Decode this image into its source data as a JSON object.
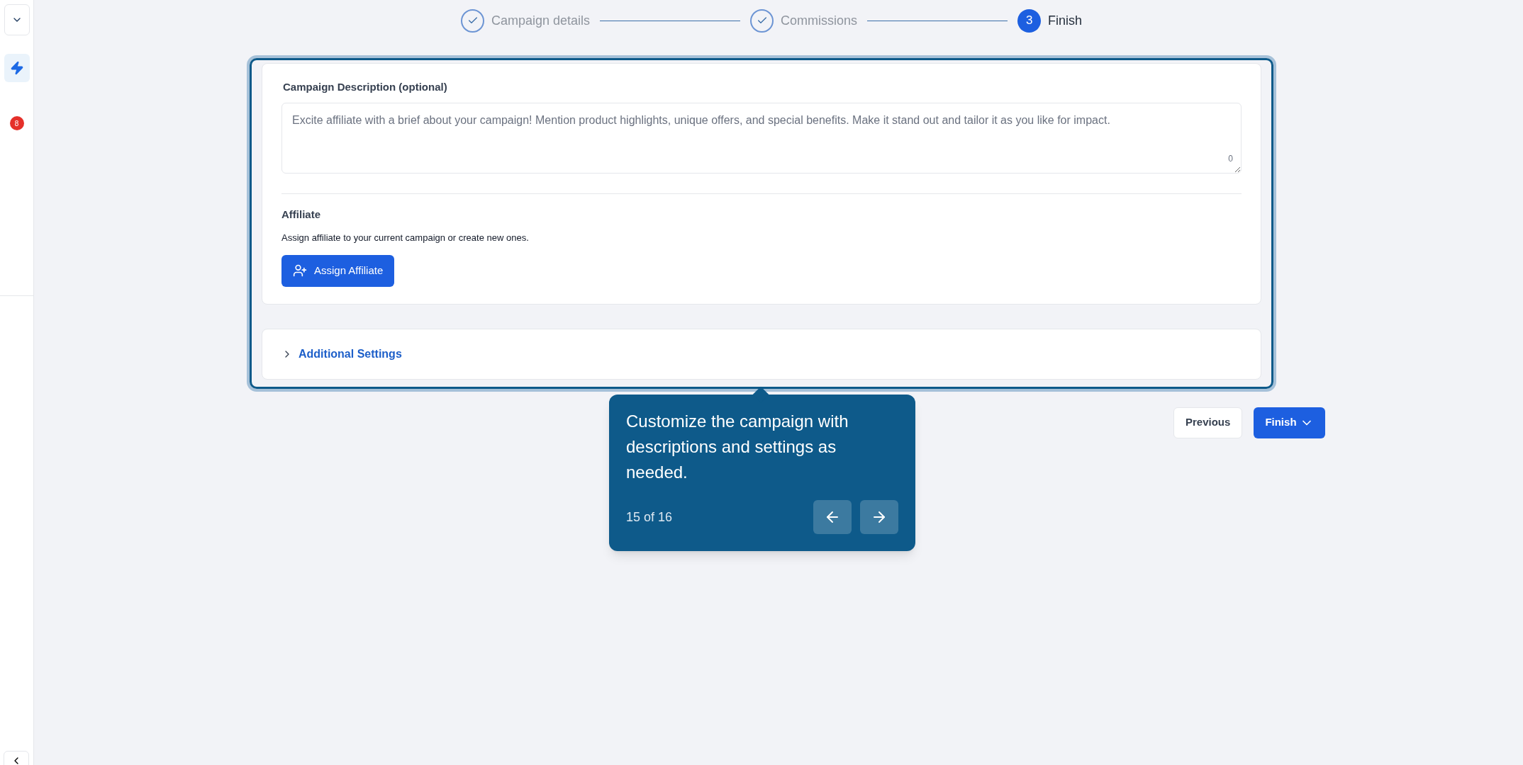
{
  "sidebar": {
    "badge": "8"
  },
  "stepper": [
    {
      "label": "Campaign details",
      "kind": "done"
    },
    {
      "label": "Commissions",
      "kind": "done"
    },
    {
      "label": "Finish",
      "kind": "active",
      "number": "3"
    }
  ],
  "description": {
    "label": "Campaign Description (optional)",
    "placeholder": "Excite affiliate with a brief about your campaign! Mention product highlights, unique offers, and special benefits. Make it stand out and tailor it as you like for impact.",
    "counter": "0"
  },
  "affiliate": {
    "title": "Affiliate",
    "text": "Assign affiliate to your current campaign or create new ones.",
    "button": "Assign Affiliate"
  },
  "additional_settings": {
    "label": "Additional Settings",
    "expanded": false
  },
  "buttons": {
    "previous": "Previous",
    "finish": "Finish"
  },
  "tooltip": {
    "text": "Customize the campaign with descriptions and settings as needed.",
    "progress": "15 of 16"
  }
}
